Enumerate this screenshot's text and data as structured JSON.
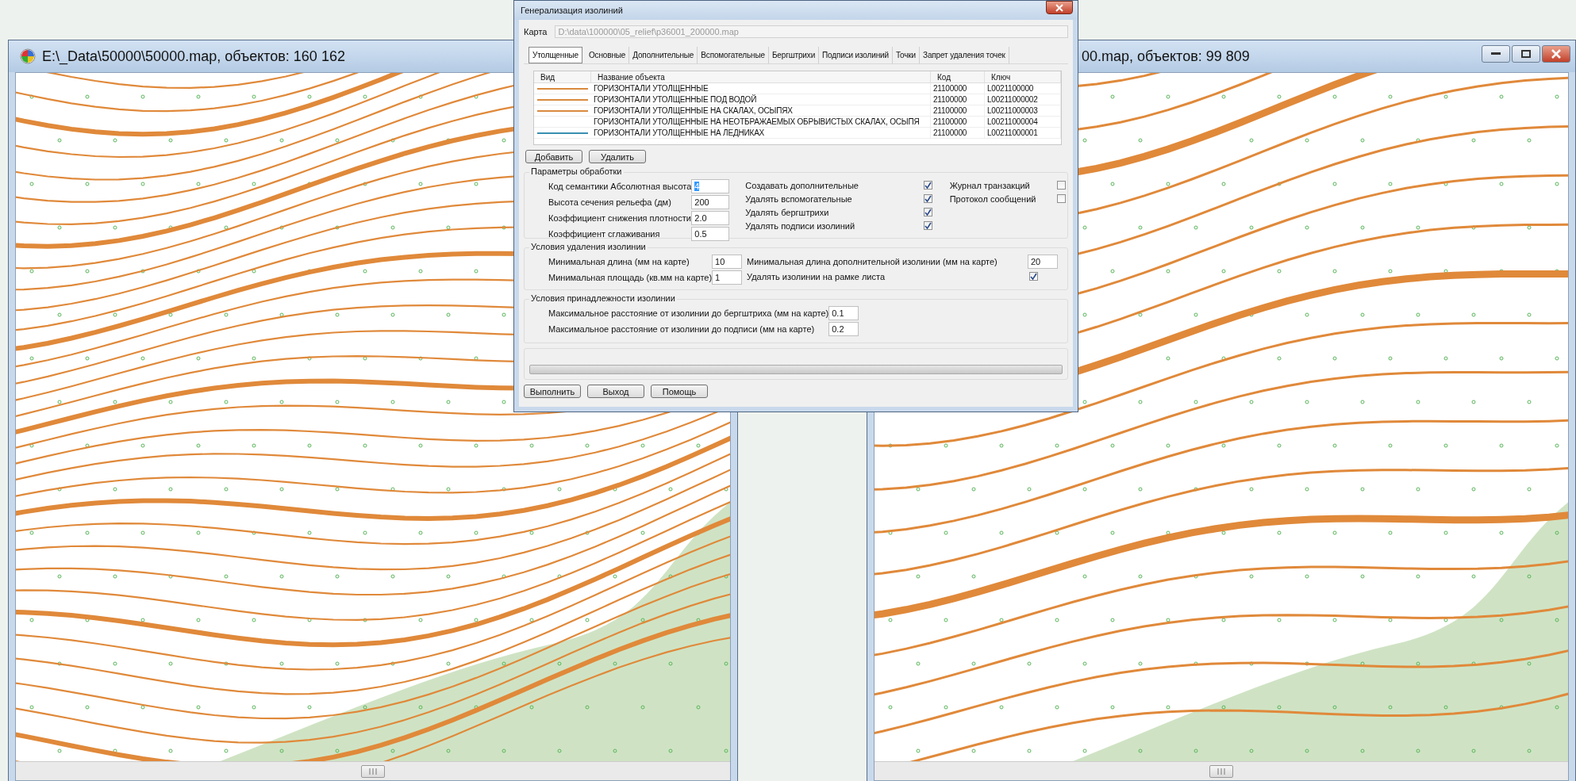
{
  "map_windows": [
    {
      "title": "E:\\_Data\\50000\\50000.map, объектов: 160 162",
      "app_icon": true,
      "window_buttons": false,
      "kind": "dense"
    },
    {
      "title": "00.map, объектов: 99 809",
      "app_icon": false,
      "window_buttons": true,
      "kind": "sparse"
    }
  ],
  "dialog": {
    "title": "Генерализация изолиний",
    "map_label": "Карта",
    "map_path": "D:\\data\\100000\\05_relief\\p36001_200000.map",
    "tabs": [
      {
        "label": "Утолщенные",
        "selected": true
      },
      {
        "label": "Основные",
        "selected": false
      },
      {
        "label": "Дополнительные",
        "selected": false
      },
      {
        "label": "Вспомогательные",
        "selected": false
      },
      {
        "label": "Бергштрихи",
        "selected": false
      },
      {
        "label": "Подписи изолиний",
        "selected": false
      },
      {
        "label": "Точки",
        "selected": false
      },
      {
        "label": "Запрет удаления точек",
        "selected": false
      }
    ],
    "table": {
      "columns": [
        "Вид",
        "Название объекта",
        "Код",
        "Ключ"
      ],
      "rows": [
        {
          "color": "#d98a3e",
          "name": "ГОРИЗОНТАЛИ УТОЛЩЕННЫЕ",
          "code": "21100000",
          "key": "L0021100000"
        },
        {
          "color": "#d98a3e",
          "name": "ГОРИЗОНТАЛИ УТОЛЩЕННЫЕ ПОД ВОДОЙ",
          "code": "21100000",
          "key": "L00211000002"
        },
        {
          "color": "#d98a3e",
          "name": "ГОРИЗОНТАЛИ УТОЛЩЕННЫЕ НА СКАЛАХ, ОСЫПЯХ",
          "code": "21100000",
          "key": "L00211000003"
        },
        {
          "name": "ГОРИЗОНТАЛИ УТОЛЩЕННЫЕ НА НЕОТБРАЖАЕМЫХ ОБРЫВИСТЫХ СКАЛАХ, ОСЫПЯ",
          "code": "21100000",
          "key": "L00211000004"
        },
        {
          "color": "#3a8fb0",
          "name": "ГОРИЗОНТАЛИ УТОЛЩЕННЫЕ НА ЛЕДНИКАХ",
          "code": "21100000",
          "key": "L00211000001"
        }
      ]
    },
    "table_buttons": [
      "Добавить",
      "Удалить"
    ],
    "groups": [
      {
        "title": "Параметры обработки",
        "columns": [
          [
            {
              "kind": "field",
              "label": "Код семантики Абсолютная высота",
              "value": "4",
              "highlighted": true
            },
            {
              "kind": "field",
              "label": "Высота сечения рельефа (дм)",
              "value": "200",
              "highlighted": false
            },
            {
              "kind": "field",
              "label": "Коэффициент снижения плотности",
              "value": "2.0",
              "highlighted": false
            },
            {
              "kind": "field",
              "label": "Коэффициент сглаживания",
              "value": "0.5",
              "highlighted": false
            }
          ],
          [
            {
              "kind": "check",
              "label": "Создавать дополнительные",
              "checked": true
            },
            {
              "kind": "check",
              "label": "Удалять вспомогательные",
              "checked": true
            },
            {
              "kind": "check",
              "label": "Удалять бергштрихи",
              "checked": true
            },
            {
              "kind": "check",
              "label": "Удалять подписи изолиний",
              "checked": true
            }
          ],
          [
            {
              "kind": "check",
              "label": "Журнал транзакций",
              "checked": false
            },
            {
              "kind": "check",
              "label": "Протокол сообщений",
              "checked": false
            }
          ]
        ]
      },
      {
        "title": "Условия удаления изолинии",
        "columns": [
          [
            {
              "kind": "field",
              "label": "Минимальная длина (мм на карте)",
              "value": "10",
              "highlighted": false
            },
            {
              "kind": "field",
              "label": "Минимальная площадь (кв.мм на карте)",
              "value": "1",
              "highlighted": false
            }
          ],
          [
            {
              "kind": "field",
              "label": "Минимальная длина дополнительной изолинии (мм на карте)",
              "value": "20",
              "highlighted": false
            },
            {
              "kind": "check",
              "label": "Удалять изолинии на рамке листа",
              "checked": true
            }
          ]
        ]
      },
      {
        "title": "Условия принадлежности изолинии",
        "columns": [
          [
            {
              "kind": "field",
              "label": "Максимальное расстояние от изолинии до бергштриха (мм на карте)",
              "value": "0.1",
              "highlighted": false
            },
            {
              "kind": "field",
              "label": "Максимальное расстояние от изолинии до подписи (мм на карте)",
              "value": "0.2",
              "highlighted": false
            }
          ]
        ]
      }
    ],
    "progress": {
      "level": 0
    },
    "buttons": [
      "Выполнить",
      "Выход",
      "Помощь"
    ]
  }
}
